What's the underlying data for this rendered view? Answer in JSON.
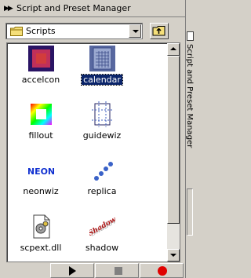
{
  "window": {
    "title": "Script and Preset Manager"
  },
  "folder": {
    "selected": "Scripts"
  },
  "items": [
    {
      "label": "accelcon",
      "icon": "accelcon-icon",
      "selected": false
    },
    {
      "label": "calendar",
      "icon": "calendar-icon",
      "selected": true
    },
    {
      "label": "fillout",
      "icon": "fillout-icon",
      "selected": false
    },
    {
      "label": "guidewiz",
      "icon": "guidewiz-icon",
      "selected": false
    },
    {
      "label": "neonwiz",
      "icon": "neonwiz-icon",
      "selected": false
    },
    {
      "label": "replica",
      "icon": "replica-icon",
      "selected": false
    },
    {
      "label": "scpext.dll",
      "icon": "dll-file-icon",
      "selected": false
    },
    {
      "label": "shadow",
      "icon": "shadow-icon",
      "selected": false
    }
  ],
  "icon_text": {
    "neon": "NEON",
    "shadow": "Shadow"
  },
  "side_panel": {
    "title": "Script and Preset Manager"
  },
  "colors": {
    "selection": "#0a246a",
    "record": "#e00000",
    "panel_bg": "#d4d0c8"
  }
}
